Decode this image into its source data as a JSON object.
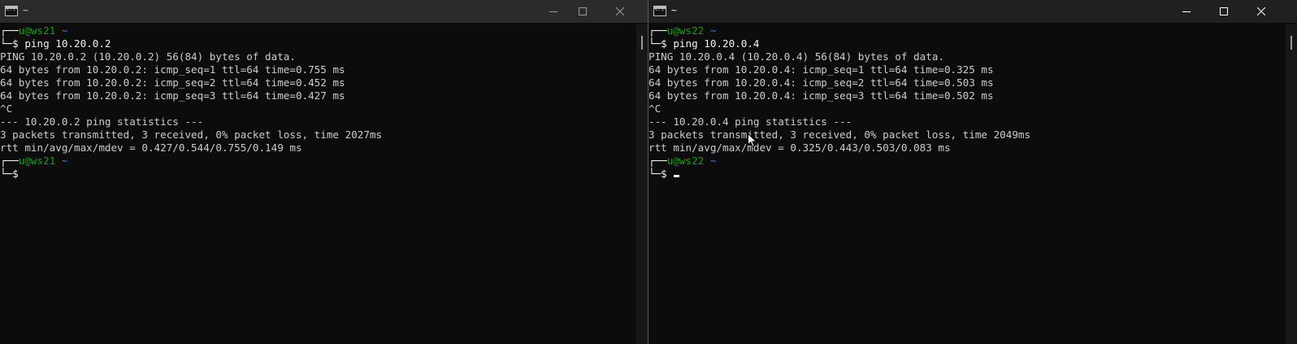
{
  "left": {
    "title": "~",
    "icon": "terminal-icon",
    "lines": [
      {
        "prompt_user": "u@ws21",
        "prompt_path": "~"
      },
      {
        "cmd": "ping 10.20.0.2"
      },
      {
        "text": "PING 10.20.0.2 (10.20.0.2) 56(84) bytes of data."
      },
      {
        "text": "64 bytes from 10.20.0.2: icmp_seq=1 ttl=64 time=0.755 ms"
      },
      {
        "text": "64 bytes from 10.20.0.2: icmp_seq=2 ttl=64 time=0.452 ms"
      },
      {
        "text": "64 bytes from 10.20.0.2: icmp_seq=3 ttl=64 time=0.427 ms"
      },
      {
        "text": "^C"
      },
      {
        "text": "--- 10.20.0.2 ping statistics ---"
      },
      {
        "text": "3 packets transmitted, 3 received, 0% packet loss, time 2027ms"
      },
      {
        "text": "rtt min/avg/max/mdev = 0.427/0.544/0.755/0.149 ms"
      },
      {
        "prompt_user": "u@ws21",
        "prompt_path": "~"
      },
      {
        "cmd": ""
      }
    ]
  },
  "right": {
    "title": "~",
    "icon": "terminal-icon",
    "lines": [
      {
        "prompt_user": "u@ws22",
        "prompt_path": "~"
      },
      {
        "cmd": "ping 10.20.0.4"
      },
      {
        "text": "PING 10.20.0.4 (10.20.0.4) 56(84) bytes of data."
      },
      {
        "text": "64 bytes from 10.20.0.4: icmp_seq=1 ttl=64 time=0.325 ms"
      },
      {
        "text": "64 bytes from 10.20.0.4: icmp_seq=2 ttl=64 time=0.503 ms"
      },
      {
        "text": "64 bytes from 10.20.0.4: icmp_seq=3 ttl=64 time=0.502 ms"
      },
      {
        "text": "^C"
      },
      {
        "text": "--- 10.20.0.4 ping statistics ---"
      },
      {
        "text": "3 packets transmitted, 3 received, 0% packet loss, time 2049ms"
      },
      {
        "text": "rtt min/avg/max/mdev = 0.325/0.443/0.503/0.083 ms"
      },
      {
        "prompt_user": "u@ws22",
        "prompt_path": "~"
      },
      {
        "cmd": "",
        "cursor": true
      }
    ]
  },
  "prompt": {
    "line1_prefix": "┌──",
    "line2_prefix": "└─",
    "dollar": "$ "
  },
  "icons": {
    "minimize": "minimize-icon",
    "maximize": "maximize-icon",
    "close": "close-icon",
    "pointer": "mouse-pointer-icon"
  },
  "colors": {
    "background": "#0c0c0c",
    "text": "#cccccc",
    "prompt_user": "#13a10e",
    "prompt_path": "#3b78ff"
  }
}
